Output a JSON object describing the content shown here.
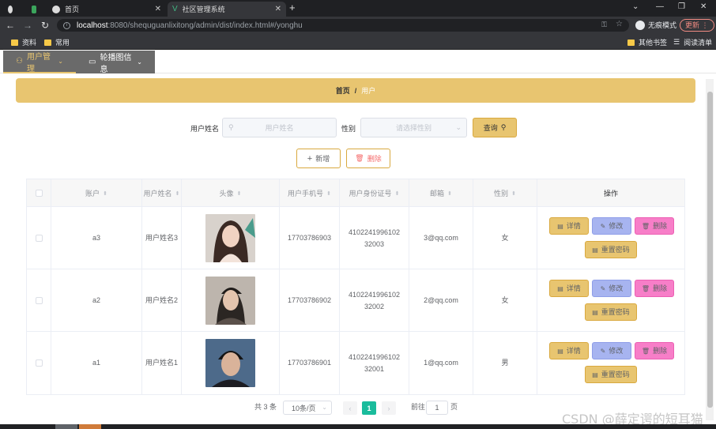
{
  "browser": {
    "tabs": [
      {
        "title": "首页"
      },
      {
        "title": "社区管理系统"
      }
    ],
    "url_host": "localhost",
    "url_rest": ":8080/shequguanlixitong/admin/dist/index.html#/yonghu",
    "incognito_label": "无痕模式",
    "update_label": "更新",
    "bookmarks": [
      "资料",
      "常用",
      "其他书签",
      "阅读清单"
    ]
  },
  "menu": {
    "items": [
      {
        "label": "用户管理",
        "active": true
      },
      {
        "label": "轮播图信息",
        "active": false
      }
    ]
  },
  "breadcrumb": {
    "home": "首页",
    "separator": "/",
    "current": "用户"
  },
  "search": {
    "name_label": "用户姓名",
    "name_placeholder": "用户姓名",
    "gender_label": "性别",
    "gender_placeholder": "请选择性别",
    "query_label": "查询"
  },
  "actions": {
    "add_label": "新增",
    "delete_label": "删除"
  },
  "table": {
    "columns": [
      "账户",
      "用户姓名",
      "头像",
      "用户手机号",
      "用户身份证号",
      "邮箱",
      "性别",
      "操作"
    ],
    "rows": [
      {
        "account": "a3",
        "name": "用户姓名3",
        "phone": "17703786903",
        "id_line1": "4102241996102",
        "id_line2": "32003",
        "email": "3@qq.com",
        "gender": "女"
      },
      {
        "account": "a2",
        "name": "用户姓名2",
        "phone": "17703786902",
        "id_line1": "4102241996102",
        "id_line2": "32002",
        "email": "2@qq.com",
        "gender": "女"
      },
      {
        "account": "a1",
        "name": "用户姓名1",
        "phone": "17703786901",
        "id_line1": "4102241996102",
        "id_line2": "32001",
        "email": "1@qq.com",
        "gender": "男"
      }
    ],
    "op_labels": {
      "detail": "详情",
      "edit": "修改",
      "remove": "删除",
      "reset": "重置密码"
    }
  },
  "pagination": {
    "total": "共 3 条",
    "page_size": "10条/页",
    "current_page": "1",
    "goto_prefix": "前往",
    "goto_value": "1",
    "goto_suffix": "页"
  },
  "watermark": "CSDN @薛定谔的短耳猫",
  "colors": {
    "accent": "#e8c570",
    "menu_bg": "#6a6a6a",
    "page_active": "#1abc9c"
  }
}
